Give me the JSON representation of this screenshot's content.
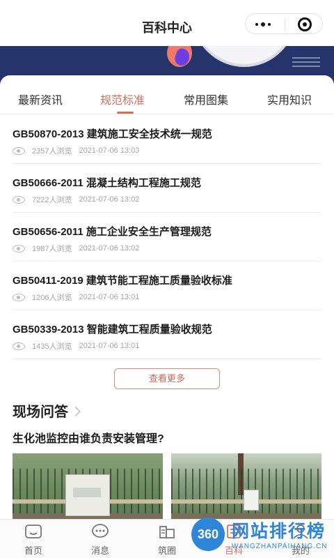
{
  "header": {
    "title": "百科中心",
    "capsule": {
      "more_icon": "more-dots-icon",
      "close_icon": "target-close-icon"
    }
  },
  "tabs": [
    {
      "label": "最新资讯",
      "active": false
    },
    {
      "label": "规范标准",
      "active": true
    },
    {
      "label": "常用图集",
      "active": false
    },
    {
      "label": "实用知识",
      "active": false
    }
  ],
  "articles": [
    {
      "title": "GB50870-2013 建筑施工安全技术统一规范",
      "views": "2357人浏览",
      "time": "2021-07-06 13:03"
    },
    {
      "title": "GB50666-2011 混凝土结构工程施工规范",
      "views": "7222人浏览",
      "time": "2021-07-06 13:02"
    },
    {
      "title": "GB50656-2011 施工企业安全生产管理规范",
      "views": "1987人浏览",
      "time": "2021-07-06 13:02"
    },
    {
      "title": "GB50411-2019 建筑节能工程施工质量验收标准",
      "views": "1206人浏览",
      "time": "2021-07-06 13:01"
    },
    {
      "title": "GB50339-2013 智能建筑工程质量验收规范",
      "views": "1435人浏览",
      "time": "2021-07-06 13:01"
    }
  ],
  "view_more_label": "查看更多",
  "qa": {
    "section_title": "现场问答",
    "question": "生化池监控由谁负责安装管理?"
  },
  "bottom_nav": [
    {
      "label": "首页",
      "icon": "home-icon",
      "active": false
    },
    {
      "label": "消息",
      "icon": "message-icon",
      "active": false
    },
    {
      "label": "筑圈",
      "icon": "circle-icon",
      "active": false
    },
    {
      "label": "百科",
      "icon": "encyclopedia-icon",
      "active": true
    },
    {
      "label": "我的",
      "icon": "profile-icon",
      "active": false
    }
  ],
  "watermark": {
    "badge": "360",
    "cn": "网站排行榜",
    "en": "WANGZHANPAIHANG.CN"
  },
  "colors": {
    "accent": "#d0705c",
    "banner": "#25356b",
    "watermark": "#2f86d8"
  }
}
